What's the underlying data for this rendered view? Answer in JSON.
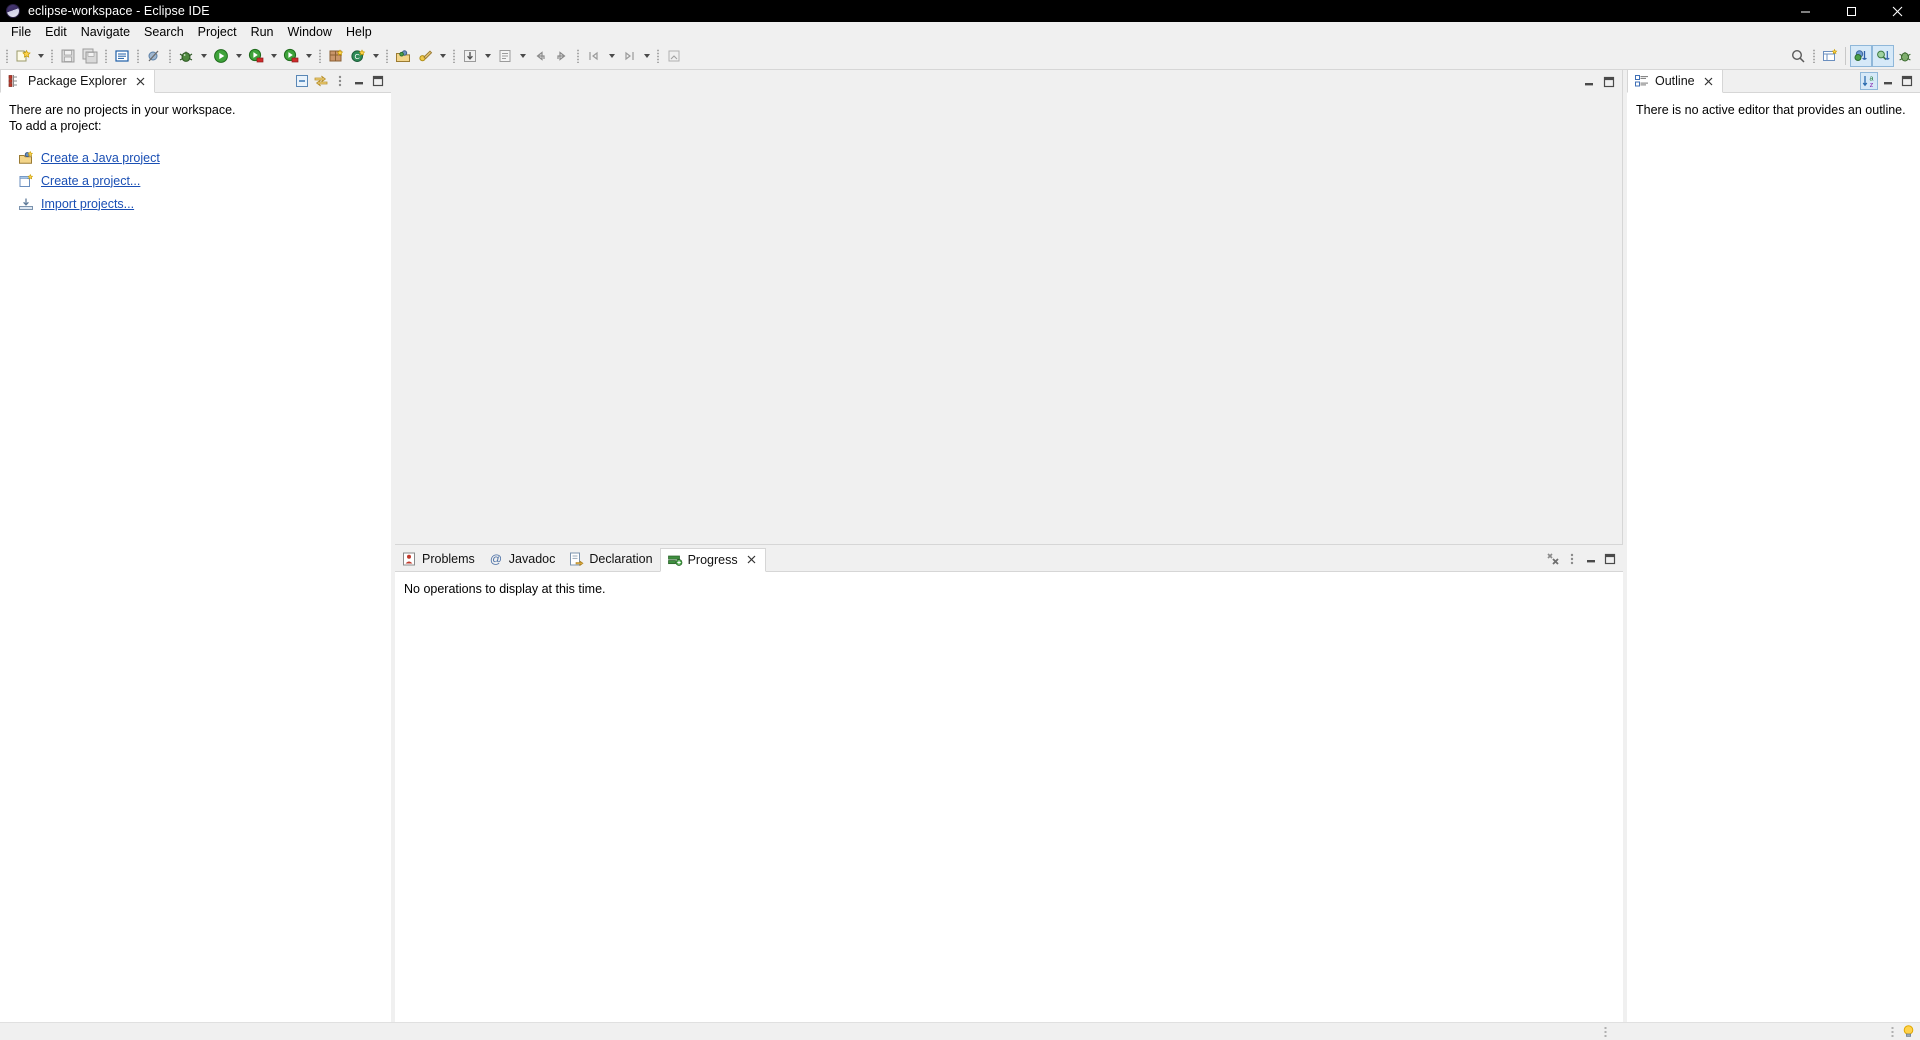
{
  "window": {
    "title": "eclipse-workspace - Eclipse IDE",
    "app_icon": "eclipse-logo-icon",
    "controls": {
      "minimize": "minimize-icon",
      "maximize": "maximize-icon",
      "close": "close-icon"
    }
  },
  "menubar": {
    "items": [
      {
        "label": "File"
      },
      {
        "label": "Edit"
      },
      {
        "label": "Navigate"
      },
      {
        "label": "Search"
      },
      {
        "label": "Project"
      },
      {
        "label": "Run"
      },
      {
        "label": "Window"
      },
      {
        "label": "Help"
      }
    ]
  },
  "toolbar": {
    "items": [
      {
        "name": "new-wizard-button",
        "icon": "new-file-icon",
        "dropdown": true
      },
      {
        "name": "save-button",
        "icon": "save-icon",
        "dropdown": false
      },
      {
        "name": "save-all-button",
        "icon": "save-all-icon",
        "dropdown": false
      },
      {
        "name": "open-type-button",
        "icon": "open-type-icon",
        "dropdown": false
      },
      {
        "name": "skip-breakpoints-button",
        "icon": "skip-breakpoints-icon",
        "dropdown": false
      },
      {
        "name": "debug-button",
        "icon": "debug-bug-icon",
        "dropdown": true
      },
      {
        "name": "run-button",
        "icon": "run-play-icon",
        "dropdown": true
      },
      {
        "name": "coverage-button",
        "icon": "coverage-icon",
        "dropdown": true
      },
      {
        "name": "external-tools-button",
        "icon": "external-tools-icon",
        "dropdown": true
      },
      {
        "name": "new-java-package-button",
        "icon": "new-package-icon",
        "dropdown": false
      },
      {
        "name": "new-java-class-button",
        "icon": "new-class-icon",
        "dropdown": true
      },
      {
        "name": "new-java-project-button",
        "icon": "new-java-project-icon",
        "dropdown": false
      },
      {
        "name": "open-task-button",
        "icon": "task-repository-icon",
        "dropdown": true
      },
      {
        "name": "previous-annotation-button",
        "icon": "arrow-down-annotation-icon",
        "dropdown": true
      },
      {
        "name": "next-annotation-button",
        "icon": "next-annotation-icon",
        "dropdown": true
      },
      {
        "name": "back-history-button",
        "icon": "back-arrow-icon",
        "dropdown": false
      },
      {
        "name": "forward-history-button",
        "icon": "forward-arrow-icon",
        "dropdown": false
      },
      {
        "name": "previous-edit-button",
        "icon": "previous-edit-icon",
        "dropdown": true
      },
      {
        "name": "next-edit-button",
        "icon": "next-edit-icon",
        "dropdown": true
      },
      {
        "name": "pin-editor-button",
        "icon": "pin-editor-icon",
        "dropdown": false
      }
    ],
    "right_items": [
      {
        "name": "quick-access-button",
        "icon": "search-icon"
      },
      {
        "name": "open-perspective-button",
        "icon": "open-perspective-icon"
      },
      {
        "name": "perspective-java-button",
        "icon": "java-perspective-icon",
        "active": true
      },
      {
        "name": "perspective-java-browsing-button",
        "icon": "java-browsing-perspective-icon",
        "active": true
      },
      {
        "name": "perspective-debug-button",
        "icon": "debug-perspective-icon",
        "active": false
      }
    ]
  },
  "package_explorer": {
    "tab_label": "Package Explorer",
    "tab_icon": "package-explorer-icon",
    "closable": true,
    "tools": [
      {
        "name": "collapse-all-button",
        "icon": "collapse-all-icon"
      },
      {
        "name": "link-with-editor-button",
        "icon": "link-with-editor-icon"
      },
      {
        "name": "view-menu-button",
        "icon": "view-menu-icon"
      },
      {
        "name": "minimize-view-button",
        "icon": "minimize-icon"
      },
      {
        "name": "maximize-view-button",
        "icon": "maximize-icon"
      }
    ],
    "empty_message_line1": "There are no projects in your workspace.",
    "empty_message_line2": "To add a project:",
    "links": [
      {
        "label": "Create a Java project",
        "icon": "new-java-project-icon"
      },
      {
        "label": "Create a project...",
        "icon": "new-project-icon"
      },
      {
        "label": "Import projects...",
        "icon": "import-projects-icon"
      }
    ]
  },
  "editor_area": {
    "tools": [
      {
        "name": "minimize-editor-area-button",
        "icon": "minimize-icon"
      },
      {
        "name": "maximize-editor-area-button",
        "icon": "maximize-icon"
      }
    ]
  },
  "outline": {
    "tab_label": "Outline",
    "tab_icon": "outline-icon",
    "closable": true,
    "tools": [
      {
        "name": "sort-outline-button",
        "icon": "sort-az-icon",
        "active": true
      },
      {
        "name": "minimize-view-button",
        "icon": "minimize-icon",
        "active": false
      },
      {
        "name": "maximize-view-button",
        "icon": "maximize-icon",
        "active": false
      }
    ],
    "message": "There is no active editor that provides an outline."
  },
  "bottom_panel": {
    "tabs": [
      {
        "label": "Problems",
        "icon": "problems-icon",
        "selected": false,
        "closable": false
      },
      {
        "label": "Javadoc",
        "icon": "javadoc-icon",
        "selected": false,
        "closable": false
      },
      {
        "label": "Declaration",
        "icon": "declaration-icon",
        "selected": false,
        "closable": false
      },
      {
        "label": "Progress",
        "icon": "progress-icon",
        "selected": true,
        "closable": true
      }
    ],
    "tools": [
      {
        "name": "cancel-all-operations-button",
        "icon": "cancel-all-icon"
      },
      {
        "name": "view-menu-button",
        "icon": "view-menu-icon"
      },
      {
        "name": "minimize-view-button",
        "icon": "minimize-icon"
      },
      {
        "name": "maximize-view-button",
        "icon": "maximize-icon"
      }
    ],
    "message": "No operations to display at this time."
  },
  "statusbar": {
    "left_text": "",
    "right_icon": "tip-of-the-day-bulb-icon"
  },
  "colors": {
    "titlebar_bg": "#000000",
    "chrome_bg": "#f0f0f0",
    "panel_bg": "#ffffff",
    "link": "#1a4fb4",
    "accent_selected_tool": "#d6e9f8"
  }
}
